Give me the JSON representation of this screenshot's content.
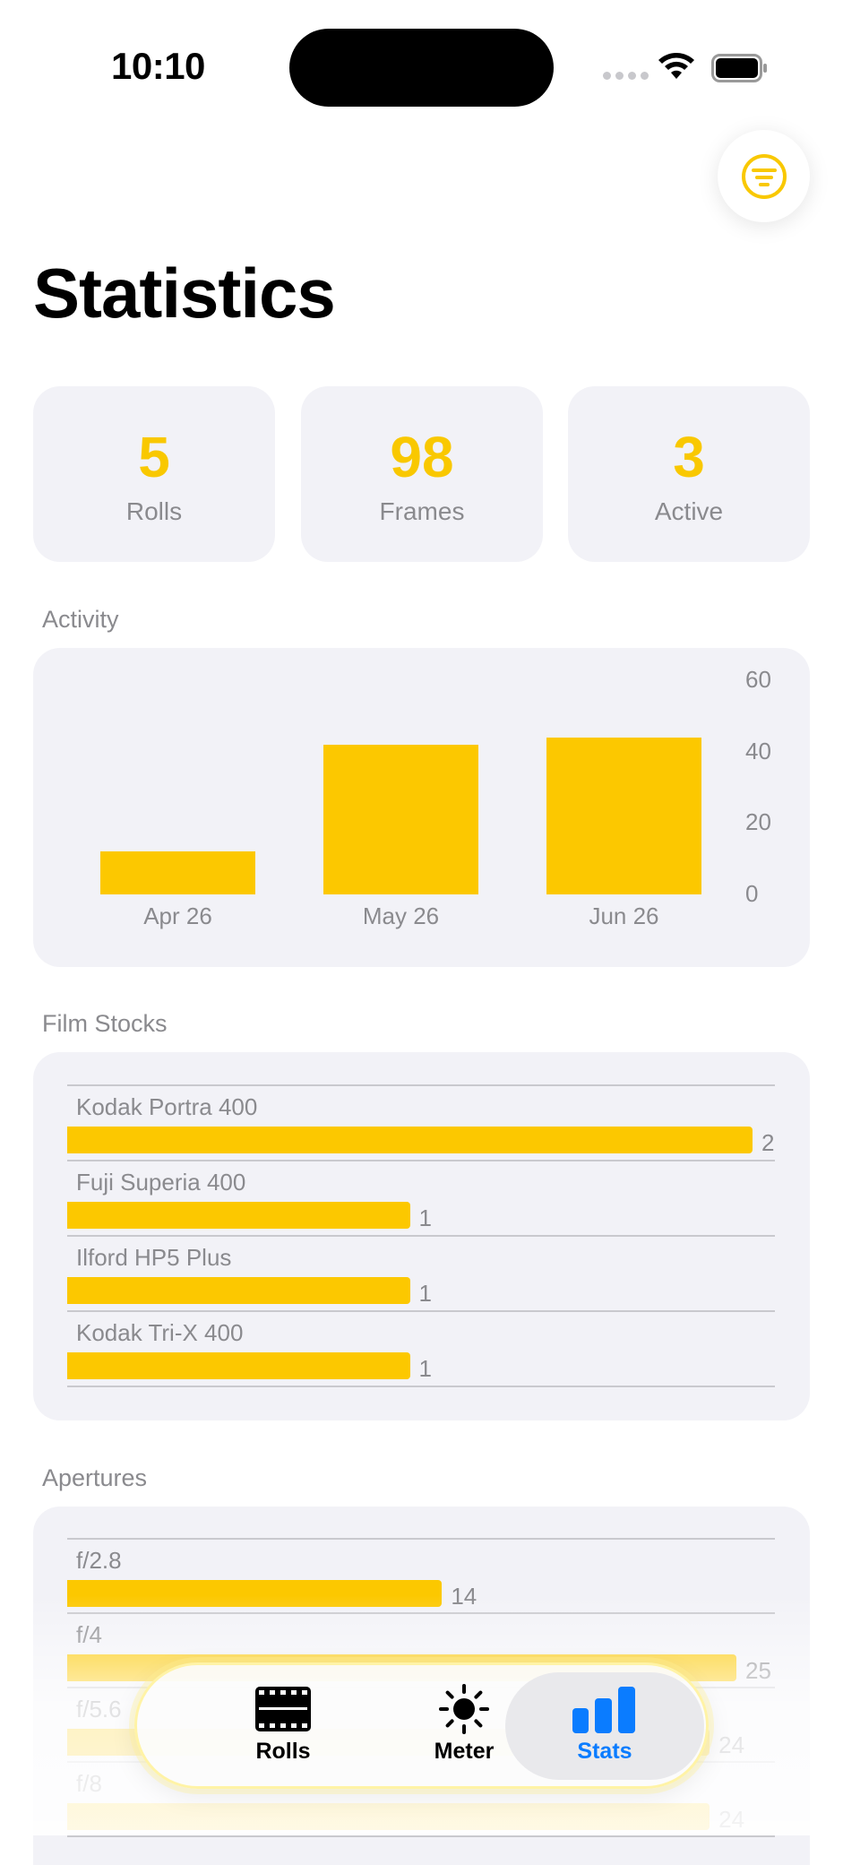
{
  "status": {
    "time": "10:10"
  },
  "header": {
    "title": "Statistics"
  },
  "summary": [
    {
      "value": "5",
      "label": "Rolls"
    },
    {
      "value": "98",
      "label": "Frames"
    },
    {
      "value": "3",
      "label": "Active"
    }
  ],
  "sections": {
    "activity": "Activity",
    "film_stocks": "Film Stocks",
    "apertures": "Apertures"
  },
  "chart_data": [
    {
      "type": "bar",
      "categories": [
        "Apr 26",
        "May 26",
        "Jun 26"
      ],
      "values": [
        12,
        42,
        44
      ],
      "ylim": [
        0,
        60
      ],
      "yticks": [
        "0",
        "20",
        "40",
        "60"
      ]
    },
    {
      "type": "bar",
      "orientation": "horizontal",
      "categories": [
        "Kodak Portra 400",
        "Fuji Superia 400",
        "Ilford HP5 Plus",
        "Kodak Tri-X 400"
      ],
      "values": [
        2,
        1,
        1,
        1
      ],
      "xlim": [
        0,
        2
      ]
    },
    {
      "type": "bar",
      "orientation": "horizontal",
      "categories": [
        "f/2.8",
        "f/4",
        "f/5.6",
        "f/8"
      ],
      "values": [
        14,
        25,
        24,
        24
      ],
      "xlim": [
        0,
        25
      ]
    }
  ],
  "tabs": [
    {
      "label": "Rolls",
      "icon": "film-icon"
    },
    {
      "label": "Meter",
      "icon": "sun-icon"
    },
    {
      "label": "Stats",
      "icon": "chart-icon",
      "active": true
    }
  ],
  "colors": {
    "accent": "#fcc800",
    "active_tab": "#0a7cff"
  }
}
